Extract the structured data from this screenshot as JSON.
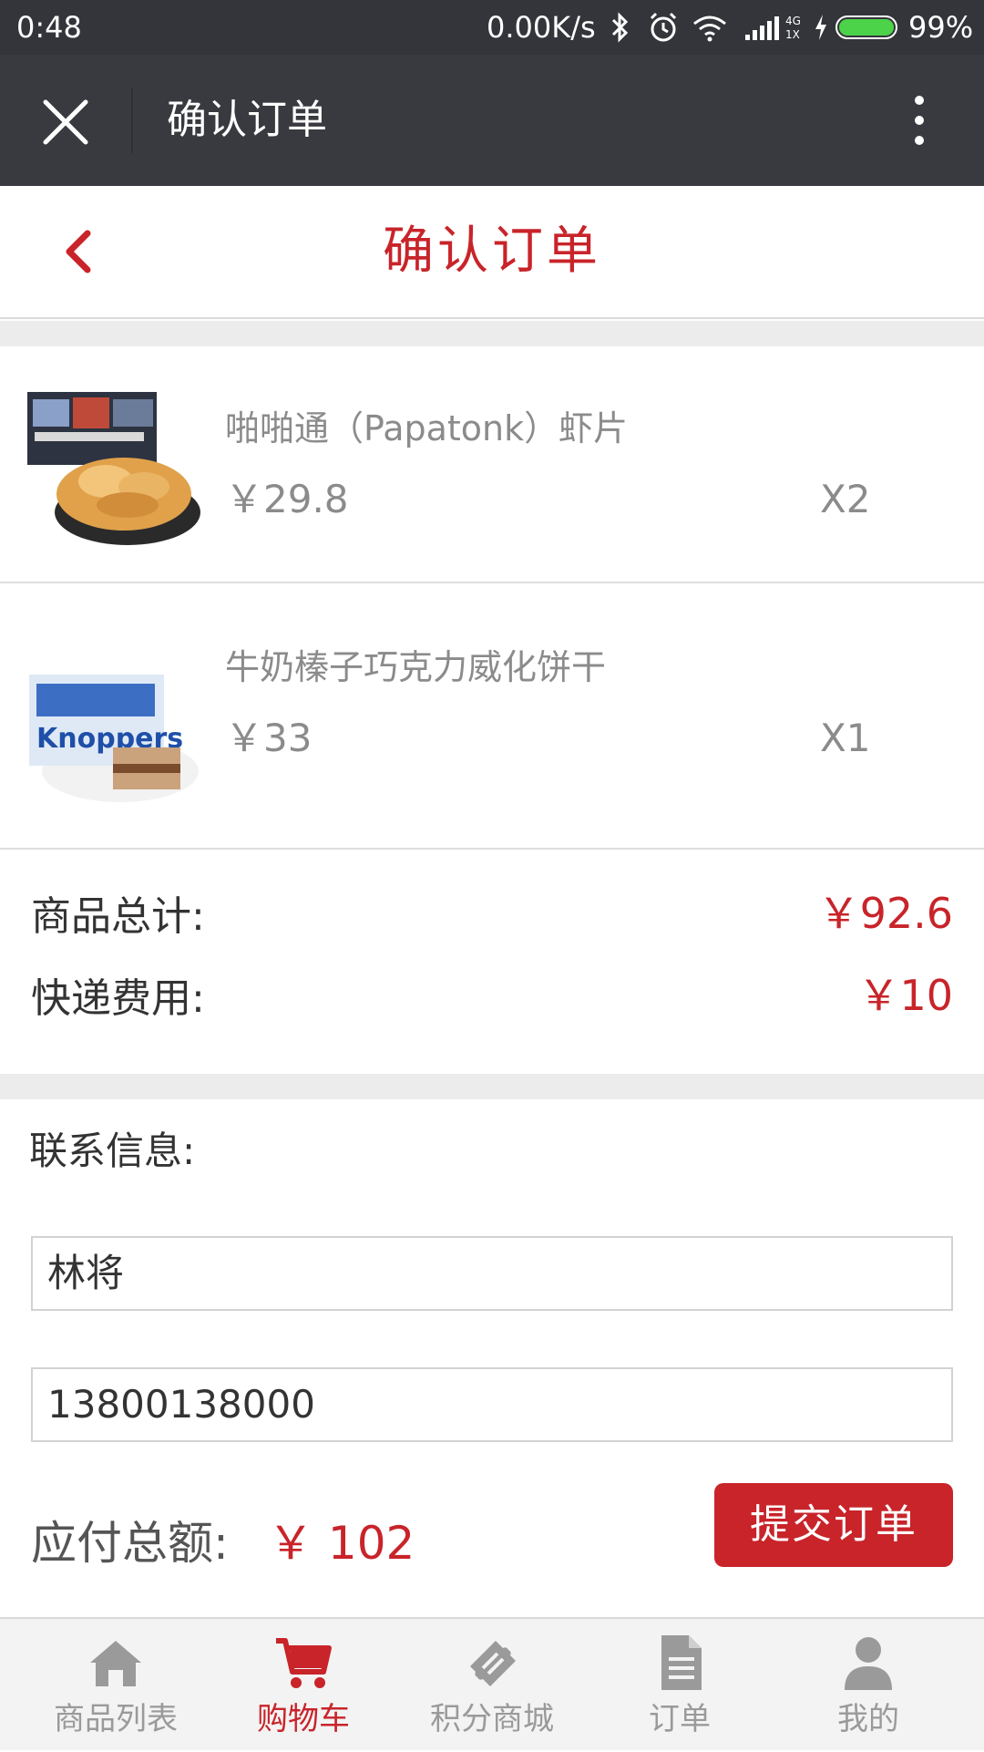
{
  "status_bar": {
    "time": "0:48",
    "speed": "0.00K/s",
    "battery": "99%"
  },
  "wx_bar": {
    "title": "确认订单"
  },
  "header": {
    "title": "确认订单"
  },
  "items": [
    {
      "name": "啪啪通（Papatonk）虾片",
      "price": "￥29.8",
      "qty": "X2"
    },
    {
      "name": "牛奶榛子巧克力威化饼干",
      "price": "￥33",
      "qty": "X1"
    }
  ],
  "totals": {
    "goods_label": "商品总计:",
    "goods_value": "￥92.6",
    "shipping_label": "快递费用:",
    "shipping_value": "￥10"
  },
  "contact": {
    "label": "联系信息:",
    "name_value": "林将",
    "phone_value": "13800138000"
  },
  "payment": {
    "label": "应付总额:",
    "value": "￥ 102",
    "submit_label": "提交订单"
  },
  "tabs": [
    {
      "label": "商品列表",
      "icon": "home-icon",
      "active": false
    },
    {
      "label": "购物车",
      "icon": "cart-icon",
      "active": true
    },
    {
      "label": "积分商城",
      "icon": "ticket-icon",
      "active": false
    },
    {
      "label": "订单",
      "icon": "document-icon",
      "active": false
    },
    {
      "label": "我的",
      "icon": "user-icon",
      "active": false
    }
  ],
  "colors": {
    "accent": "#c8242a",
    "wx_bar": "#393a3f",
    "status_bar": "#33353a"
  }
}
